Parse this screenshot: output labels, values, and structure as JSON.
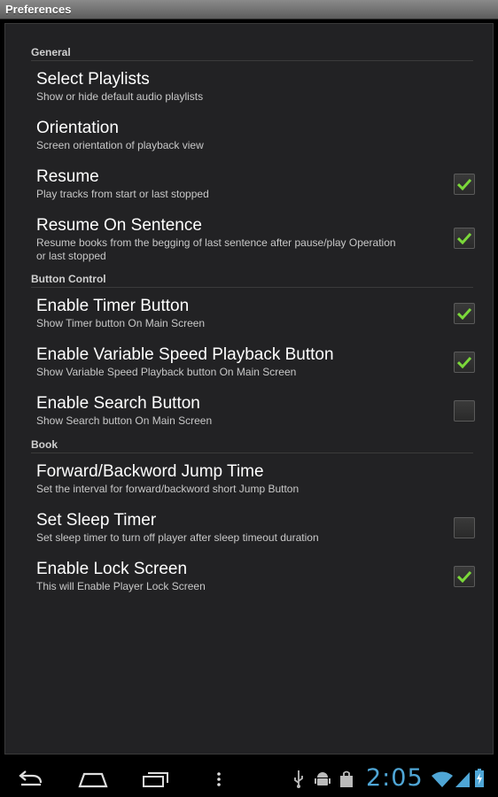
{
  "window": {
    "title": "Preferences"
  },
  "categories": {
    "general": "General",
    "button_control": "Button Control",
    "book": "Book"
  },
  "prefs": [
    {
      "title": "Select Playlists",
      "summary": "Show or hide default audio playlists"
    },
    {
      "title": "Orientation",
      "summary": "Screen orientation of playback view"
    },
    {
      "title": "Resume",
      "summary": "Play tracks from start or last stopped",
      "checked": true
    },
    {
      "title": "Resume On Sentence",
      "summary": "Resume books from the begging of last sentence after pause/play Operation or last stopped",
      "checked": true
    },
    {
      "title": "Enable Timer Button",
      "summary": "Show Timer button On Main Screen",
      "checked": true
    },
    {
      "title": "Enable Variable Speed Playback Button",
      "summary": "Show Variable Speed Playback button On Main Screen",
      "checked": true
    },
    {
      "title": "Enable Search Button",
      "summary": "Show Search button On Main Screen",
      "checked": false
    },
    {
      "title": "Forward/Backword Jump Time",
      "summary": "Set the interval for forward/backword short Jump Button"
    },
    {
      "title": "Set Sleep Timer",
      "summary": "Set sleep timer to turn off player after sleep timeout duration",
      "checked": false
    },
    {
      "title": "Enable Lock Screen",
      "summary": "This will Enable Player Lock Screen",
      "checked": true
    }
  ],
  "statusbar": {
    "clock": "2:05",
    "icons": [
      "usb-icon",
      "android-debug-icon",
      "shopping-bag-icon",
      "wifi-icon",
      "signal-icon",
      "battery-charging-icon"
    ],
    "clock_color": "#4fa6d6"
  },
  "navbar": {
    "icons": [
      "back-icon",
      "home-icon",
      "recent-apps-icon",
      "menu-icon"
    ]
  },
  "colors": {
    "check_green": "#7bd83a",
    "panel_bg": "#222224"
  }
}
